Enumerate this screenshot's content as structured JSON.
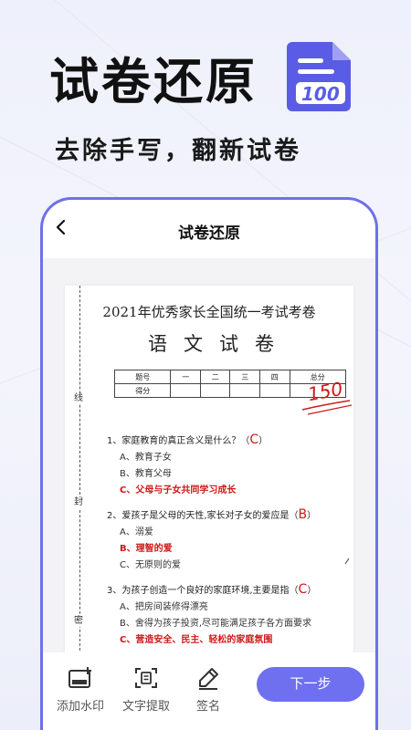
{
  "hero": {
    "title": "试卷还原",
    "subtitle": "去除手写，翻新试卷",
    "badge_text": "100",
    "accent": "#6e70f0"
  },
  "nav": {
    "back_icon": "chevron-left-icon",
    "title": "试卷还原"
  },
  "paper": {
    "binding_chars": [
      "线",
      "封",
      "密"
    ],
    "title": "2021年优秀家长全国统一考试考卷",
    "subject": "语文试卷",
    "score_table": {
      "headers": [
        "题号",
        "一",
        "二",
        "三",
        "四",
        "总分"
      ],
      "row_label": "得分",
      "handwritten_total": "150"
    },
    "questions": [
      {
        "stem": "1、家庭教育的真正含义是什么？（",
        "answer": "C",
        "close": "）",
        "options": [
          {
            "text": "A、教育子女",
            "correct": false
          },
          {
            "text": "B、教育父母",
            "correct": false
          },
          {
            "text": "C、父母与子女共同学习成长",
            "correct": true
          }
        ]
      },
      {
        "stem": "2、爱孩子是父母的天性,家长对子女的爱应是（",
        "answer": "B",
        "close": "）",
        "options": [
          {
            "text": "A、溺爱",
            "correct": false
          },
          {
            "text": "B、理智的爱",
            "correct": true
          },
          {
            "text": "C、无原则的爱",
            "correct": false
          }
        ]
      },
      {
        "stem": "3、为孩子创造一个良好的家庭环境,主要是指（",
        "answer": "C",
        "close": "）",
        "options": [
          {
            "text": "A、把房间装修得漂亮",
            "correct": false
          },
          {
            "text": "B、舍得为孩子投资,尽可能满足孩子各方面要求",
            "correct": false
          },
          {
            "text": "C、营造安全、民主、轻松的家庭氛围",
            "correct": true
          }
        ]
      }
    ]
  },
  "toolbar": {
    "watermark_label": "添加水印",
    "watermark_icon": "watermark-icon",
    "ocr_label": "文字提取",
    "ocr_icon": "scan-text-icon",
    "sign_label": "签名",
    "sign_icon": "pen-icon",
    "next_label": "下一步"
  }
}
